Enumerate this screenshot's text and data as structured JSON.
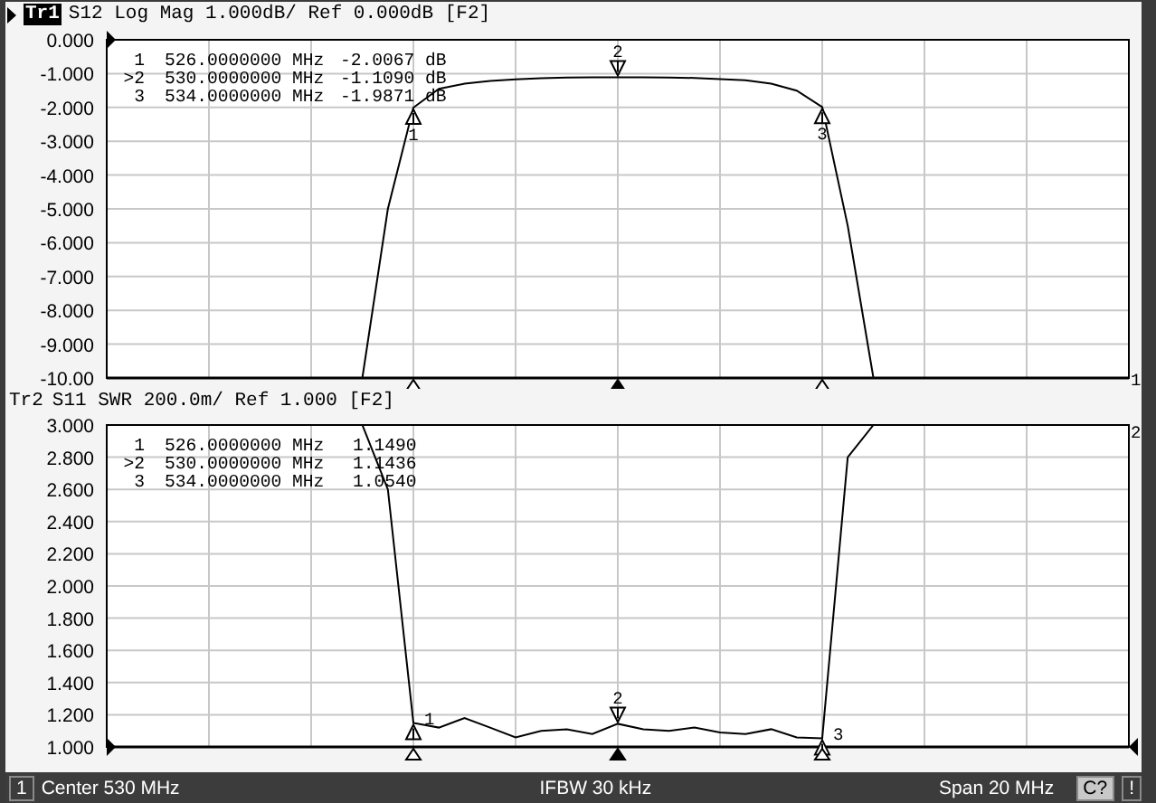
{
  "panels": [
    {
      "trace": {
        "label": "Tr1",
        "selected": true
      },
      "title": "S12 Log Mag 1.000dB/ Ref 0.000dB [F2]",
      "tag": "1",
      "chart_data": {
        "type": "line",
        "ylim": [
          -10,
          0
        ],
        "yticks": [
          {
            "value": 0,
            "label": "0.000"
          },
          {
            "value": -1,
            "label": "-1.000"
          },
          {
            "value": -2,
            "label": "-2.000"
          },
          {
            "value": -3,
            "label": "-3.000"
          },
          {
            "value": -4,
            "label": "-4.000"
          },
          {
            "value": -5,
            "label": "-5.000"
          },
          {
            "value": -6,
            "label": "-6.000"
          },
          {
            "value": -7,
            "label": "-7.000"
          },
          {
            "value": -8,
            "label": "-8.000"
          },
          {
            "value": -9,
            "label": "-9.000"
          },
          {
            "value": -10,
            "label": "-10.00"
          }
        ],
        "categories": [
          null,
          null,
          null,
          null,
          null,
          null,
          null,
          null,
          null,
          null,
          null,
          null,
          null,
          null,
          null,
          null,
          null,
          null,
          null,
          null,
          null,
          null,
          null,
          null,
          null,
          null,
          null,
          null,
          null,
          null,
          null,
          null,
          null,
          null,
          null,
          null,
          null,
          null,
          null,
          null,
          null
        ],
        "series": [
          {
            "color": "#000000",
            "values": [
              -10,
              -10,
              -10,
              -10,
              -10,
              -10,
              -10,
              -10,
              -10,
              -10,
              -10,
              -5,
              -2.0067,
              -1.45,
              -1.3,
              -1.22,
              -1.17,
              -1.14,
              -1.12,
              -1.11,
              -1.109,
              -1.11,
              -1.12,
              -1.13,
              -1.16,
              -1.2,
              -1.3,
              -1.5,
              -1.9871,
              -5.5,
              -10,
              -10,
              -10,
              -10,
              -10,
              -10,
              -10,
              -10,
              -10,
              -10,
              -10
            ]
          }
        ],
        "grid": true,
        "annotations": [
          "1",
          "2",
          "3"
        ]
      },
      "markers": [
        {
          "label": "1",
          "frequency": "526.0000000 MHz",
          "value": "-2.0067 dB",
          "selected": false,
          "level": 0.3
        },
        {
          "label": ">2",
          "frequency": "530.0000000 MHz",
          "value": "-1.1090 dB",
          "selected": true,
          "level": 0.5
        },
        {
          "label": "3",
          "frequency": "534.0000000 MHz",
          "value": "-1.9871 dB",
          "selected": false,
          "level": 0.7
        }
      ]
    },
    {
      "trace": {
        "label": "Tr2",
        "selected": false
      },
      "title": "S11 SWR 200.0m/ Ref 1.000 [F2]",
      "tag": "2",
      "chart_data": {
        "type": "line",
        "ylim": [
          1,
          3
        ],
        "yticks": [
          {
            "value": 3,
            "label": "3.000"
          },
          {
            "value": 2.8,
            "label": "2.800"
          },
          {
            "value": 2.6,
            "label": "2.600"
          },
          {
            "value": 2.4,
            "label": "2.400"
          },
          {
            "value": 2.2,
            "label": "2.200"
          },
          {
            "value": 2,
            "label": "2.000"
          },
          {
            "value": 1.8,
            "label": "1.800"
          },
          {
            "value": 1.6,
            "label": "1.600"
          },
          {
            "value": 1.4,
            "label": "1.400"
          },
          {
            "value": 1.2,
            "label": "1.200"
          },
          {
            "value": 1,
            "label": "1.000"
          }
        ],
        "categories": [
          null,
          null,
          null,
          null,
          null,
          null,
          null,
          null,
          null,
          null,
          null,
          null,
          null,
          null,
          null,
          null,
          null,
          null,
          null,
          null,
          null,
          null,
          null,
          null,
          null,
          null,
          null,
          null,
          null,
          null,
          null,
          null,
          null,
          null,
          null,
          null,
          null,
          null,
          null,
          null,
          null
        ],
        "series": [
          {
            "color": "#000000",
            "values": [
              3,
              3,
              3,
              3,
              3,
              3,
              3,
              3,
              3,
              3,
              3,
              2.6,
              1.149,
              1.12,
              1.18,
              1.12,
              1.06,
              1.1,
              1.11,
              1.08,
              1.1436,
              1.11,
              1.1,
              1.12,
              1.09,
              1.08,
              1.11,
              1.06,
              1.054,
              2.8,
              3,
              3,
              3,
              3,
              3,
              3,
              3,
              3,
              3,
              3,
              3
            ]
          }
        ],
        "grid": true,
        "annotations": [
          "1",
          "2",
          "3"
        ]
      },
      "markers": [
        {
          "label": "1",
          "frequency": "526.0000000 MHz",
          "value": "1.1490",
          "selected": false,
          "level": 0.3
        },
        {
          "label": ">2",
          "frequency": "530.0000000 MHz",
          "value": "1.1436",
          "selected": true,
          "level": 0.5
        },
        {
          "label": "3",
          "frequency": "534.0000000 MHz",
          "value": "1.0540",
          "selected": false,
          "level": 0.7
        }
      ]
    }
  ],
  "status_bar": {
    "channel": "1",
    "center": "Center 530 MHz",
    "ifbw": "IFBW 30 kHz",
    "span": "Span 20 MHz",
    "indicators": [
      "C?",
      "!"
    ]
  }
}
